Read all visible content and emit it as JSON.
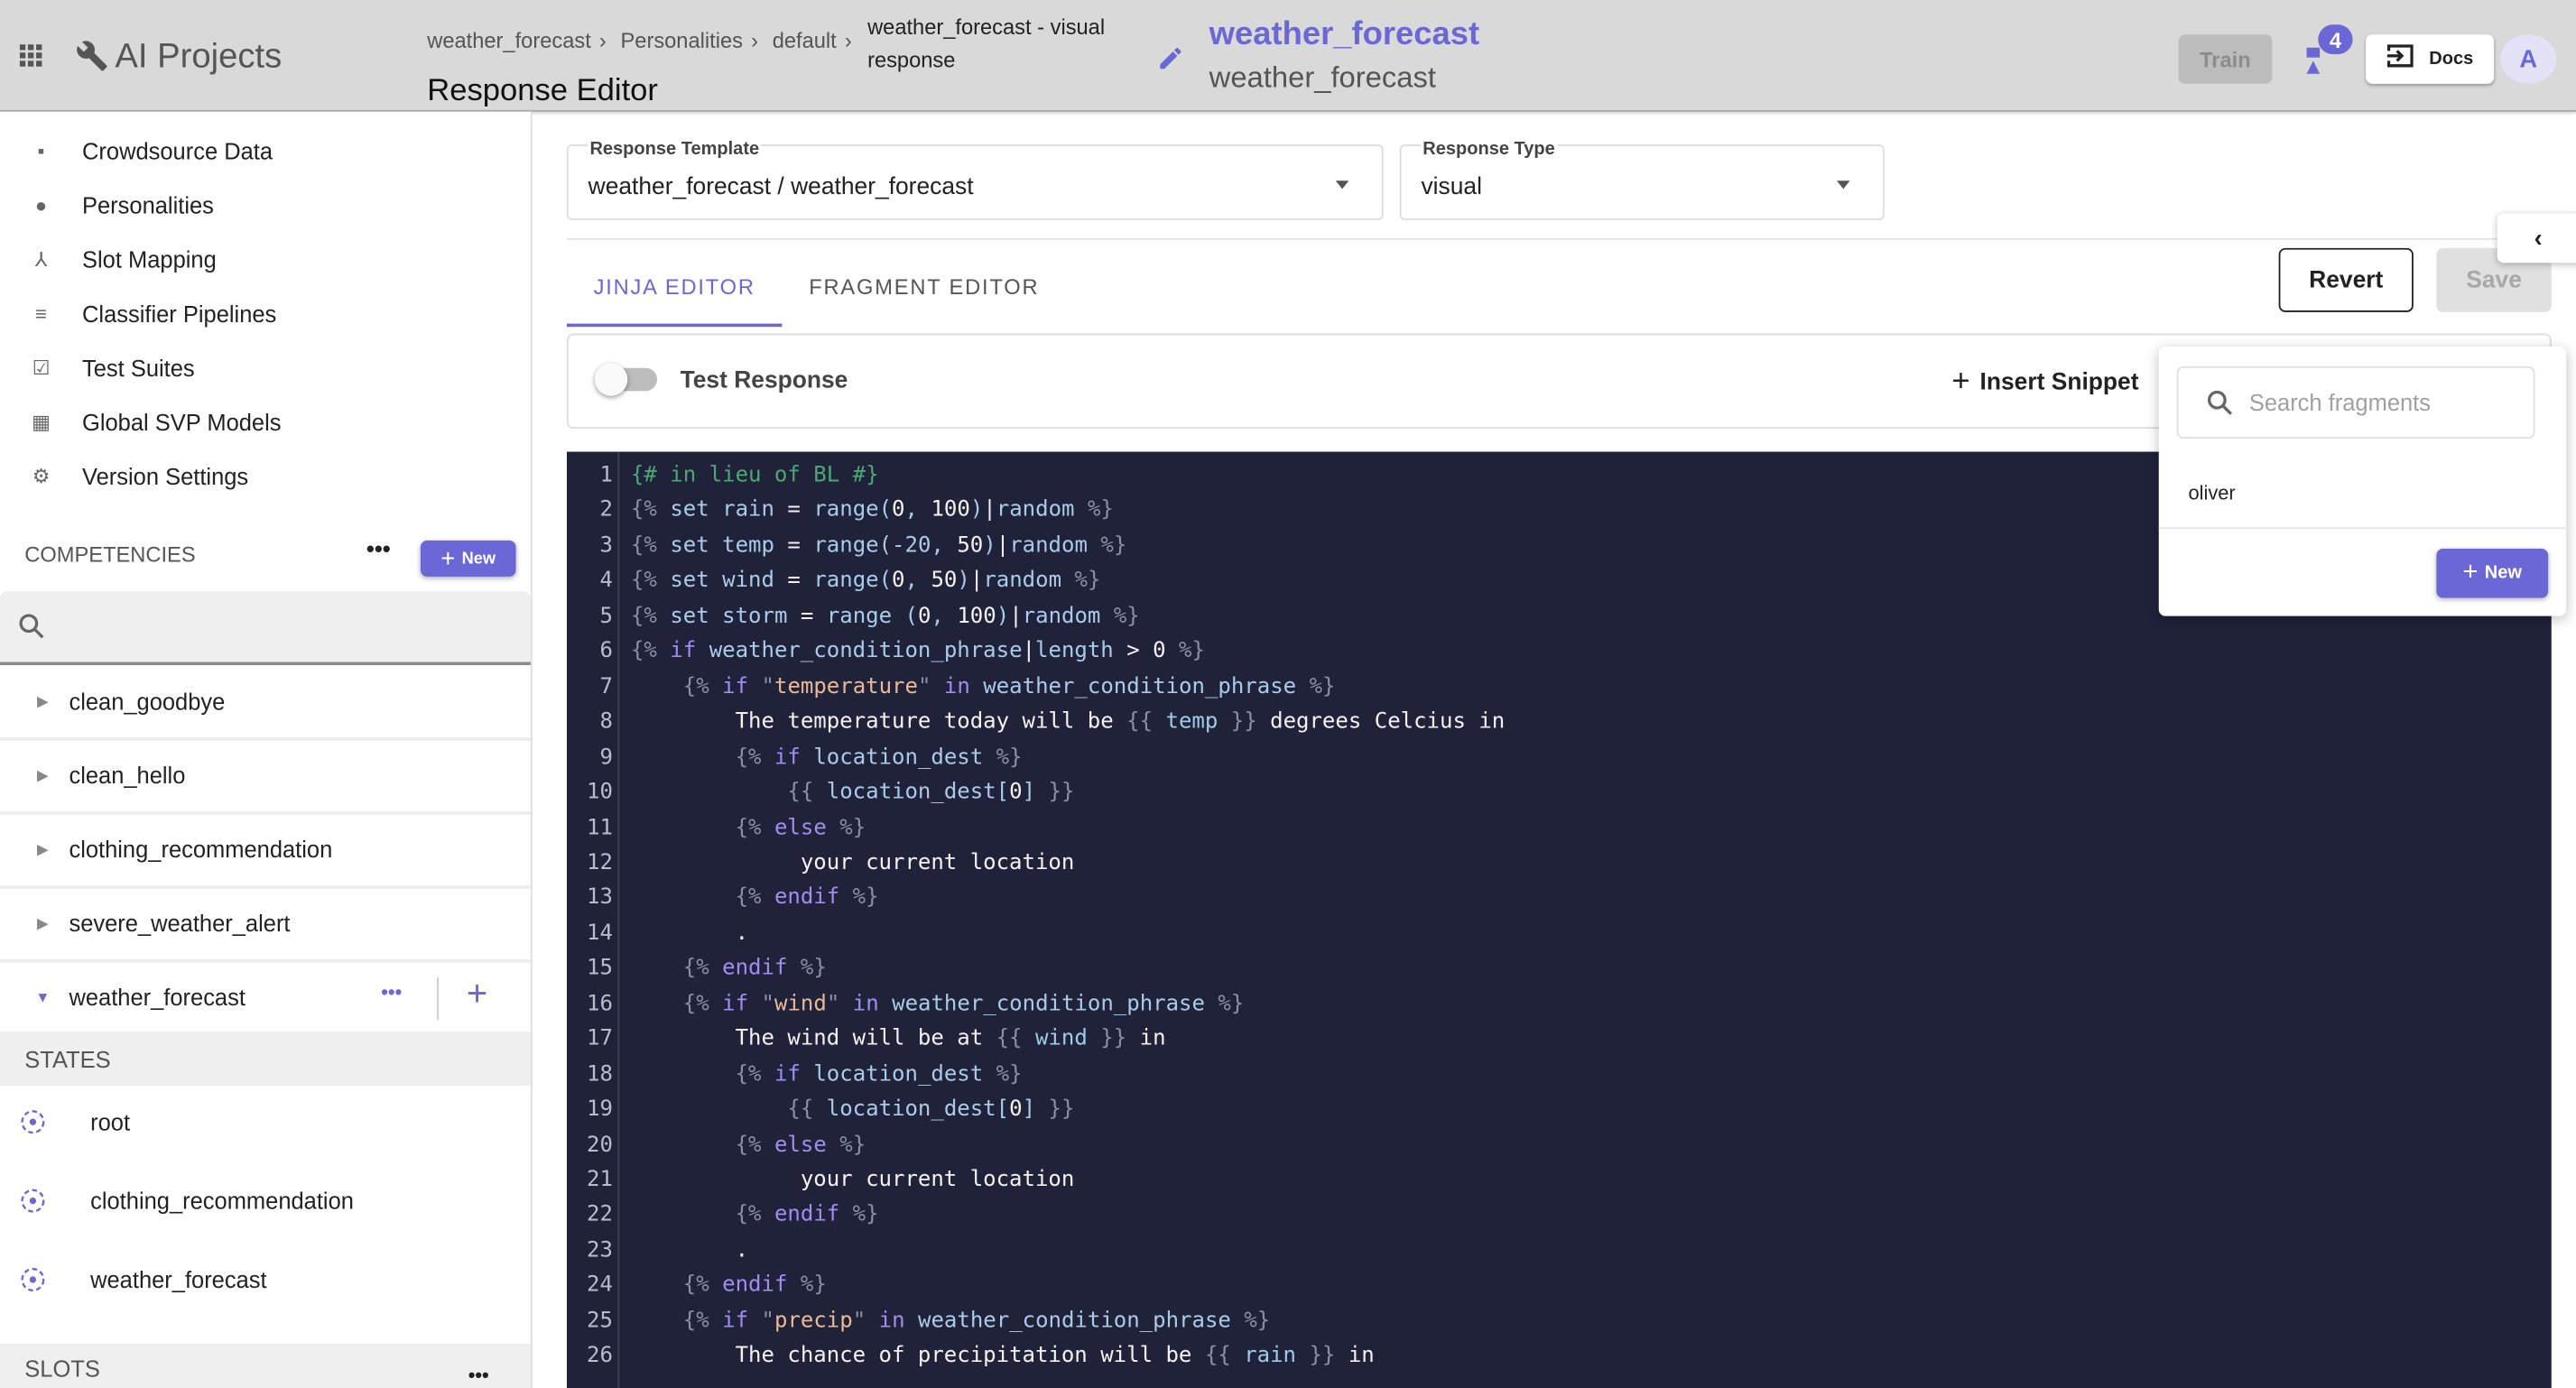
{
  "header": {
    "app_title": "AI Projects",
    "breadcrumbs": [
      "weather_forecast",
      "Personalities",
      "default"
    ],
    "breadcrumb_current": "weather_forecast - visual response",
    "page_title": "Response Editor",
    "competency_title": "weather_forecast",
    "competency_subtitle": "weather_forecast",
    "train_label": "Train",
    "notification_count": "4",
    "docs_label": "Docs",
    "avatar_initial": "A",
    "accent_color": "#6b67d6"
  },
  "sidebar": {
    "nav": [
      {
        "label": "Crowdsource Data",
        "icon": "chat-icon"
      },
      {
        "label": "Personalities",
        "icon": "person-icon"
      },
      {
        "label": "Slot Mapping",
        "icon": "hierarchy-icon"
      },
      {
        "label": "Classifier Pipelines",
        "icon": "lines-icon"
      },
      {
        "label": "Test Suites",
        "icon": "checkbox-icon"
      },
      {
        "label": "Global SVP Models",
        "icon": "grid-icon"
      },
      {
        "label": "Version Settings",
        "icon": "gear-icon"
      }
    ],
    "competencies_label": "COMPETENCIES",
    "new_label": "New",
    "competencies": [
      "clean_goodbye",
      "clean_hello",
      "clothing_recommendation",
      "severe_weather_alert",
      "weather_forecast"
    ],
    "states_label": "STATES",
    "states": [
      "root",
      "clothing_recommendation",
      "weather_forecast"
    ],
    "slots_label": "SLOTS"
  },
  "main": {
    "template_label": "Response Template",
    "template_value": "weather_forecast / weather_forecast",
    "type_label": "Response Type",
    "type_value": "visual",
    "tabs": [
      "JINJA EDITOR",
      "FRAGMENT EDITOR"
    ],
    "active_tab": 0,
    "revert_label": "Revert",
    "save_label": "Save",
    "test_response_label": "Test Response",
    "test_response_on": false,
    "insert_snippet_label": "Insert Snippet"
  },
  "fragments": {
    "search_placeholder": "Search fragments",
    "items": [
      "oliver"
    ],
    "new_label": "New"
  },
  "code_lines": [
    [
      [
        "c",
        "{# in lieu of BL #}"
      ]
    ],
    [
      [
        "d",
        "{% "
      ],
      [
        "s",
        "set rain "
      ],
      [
        "p",
        "= "
      ],
      [
        "s",
        "range("
      ],
      [
        "n",
        "0"
      ],
      [
        "s",
        ", "
      ],
      [
        "n",
        "100"
      ],
      [
        "s",
        ")"
      ],
      [
        "p",
        "|"
      ],
      [
        "s",
        "random "
      ],
      [
        "d",
        "%}"
      ]
    ],
    [
      [
        "d",
        "{% "
      ],
      [
        "s",
        "set temp "
      ],
      [
        "p",
        "= "
      ],
      [
        "s",
        "range(-20, "
      ],
      [
        "n",
        "50"
      ],
      [
        "s",
        ")"
      ],
      [
        "p",
        "|"
      ],
      [
        "s",
        "random "
      ],
      [
        "d",
        "%}"
      ]
    ],
    [
      [
        "d",
        "{% "
      ],
      [
        "s",
        "set wind "
      ],
      [
        "p",
        "= "
      ],
      [
        "s",
        "range("
      ],
      [
        "n",
        "0"
      ],
      [
        "s",
        ", "
      ],
      [
        "n",
        "50"
      ],
      [
        "s",
        ")"
      ],
      [
        "p",
        "|"
      ],
      [
        "s",
        "random "
      ],
      [
        "d",
        "%}"
      ]
    ],
    [
      [
        "d",
        "{% "
      ],
      [
        "s",
        "set storm "
      ],
      [
        "p",
        "= "
      ],
      [
        "s",
        "range ("
      ],
      [
        "n",
        "0"
      ],
      [
        "s",
        ", "
      ],
      [
        "n",
        "100"
      ],
      [
        "s",
        ")"
      ],
      [
        "p",
        "|"
      ],
      [
        "s",
        "random "
      ],
      [
        "d",
        "%}"
      ]
    ],
    [
      [
        "d",
        "{% "
      ],
      [
        "k",
        "if "
      ],
      [
        "s",
        "weather_condition_phrase"
      ],
      [
        "p",
        "|"
      ],
      [
        "s",
        "length "
      ],
      [
        "p",
        "> 0 "
      ],
      [
        "d",
        "%}"
      ]
    ],
    [
      [
        "p",
        "    "
      ],
      [
        "d",
        "{% "
      ],
      [
        "k",
        "if "
      ],
      [
        "d",
        "\""
      ],
      [
        "str",
        "temperature"
      ],
      [
        "d",
        "\" "
      ],
      [
        "k",
        "in "
      ],
      [
        "s",
        "weather_condition_phrase "
      ],
      [
        "d",
        "%}"
      ]
    ],
    [
      [
        "p",
        "        The temperature today will be "
      ],
      [
        "d",
        "{{ "
      ],
      [
        "v",
        "temp "
      ],
      [
        "d",
        "}} "
      ],
      [
        "p",
        "degrees Celcius in"
      ]
    ],
    [
      [
        "p",
        "        "
      ],
      [
        "d",
        "{% "
      ],
      [
        "k",
        "if "
      ],
      [
        "s",
        "location_dest "
      ],
      [
        "d",
        "%}"
      ]
    ],
    [
      [
        "p",
        "            "
      ],
      [
        "d",
        "{{ "
      ],
      [
        "s",
        "location_dest["
      ],
      [
        "n",
        "0"
      ],
      [
        "s",
        "] "
      ],
      [
        "d",
        "}}"
      ]
    ],
    [
      [
        "p",
        "        "
      ],
      [
        "d",
        "{% "
      ],
      [
        "k",
        "else "
      ],
      [
        "d",
        "%}"
      ]
    ],
    [
      [
        "p",
        "             your current location"
      ]
    ],
    [
      [
        "p",
        "        "
      ],
      [
        "d",
        "{% "
      ],
      [
        "k",
        "endif "
      ],
      [
        "d",
        "%}"
      ]
    ],
    [
      [
        "p",
        "        ."
      ]
    ],
    [
      [
        "p",
        "    "
      ],
      [
        "d",
        "{% "
      ],
      [
        "k",
        "endif "
      ],
      [
        "d",
        "%}"
      ]
    ],
    [
      [
        "p",
        "    "
      ],
      [
        "d",
        "{% "
      ],
      [
        "k",
        "if "
      ],
      [
        "d",
        "\""
      ],
      [
        "str",
        "wind"
      ],
      [
        "d",
        "\" "
      ],
      [
        "k",
        "in "
      ],
      [
        "s",
        "weather_condition_phrase "
      ],
      [
        "d",
        "%}"
      ]
    ],
    [
      [
        "p",
        "        The wind will be at "
      ],
      [
        "d",
        "{{ "
      ],
      [
        "v",
        "wind "
      ],
      [
        "d",
        "}} "
      ],
      [
        "p",
        "in"
      ]
    ],
    [
      [
        "p",
        "        "
      ],
      [
        "d",
        "{% "
      ],
      [
        "k",
        "if "
      ],
      [
        "s",
        "location_dest "
      ],
      [
        "d",
        "%}"
      ]
    ],
    [
      [
        "p",
        "            "
      ],
      [
        "d",
        "{{ "
      ],
      [
        "s",
        "location_dest["
      ],
      [
        "n",
        "0"
      ],
      [
        "s",
        "] "
      ],
      [
        "d",
        "}}"
      ]
    ],
    [
      [
        "p",
        "        "
      ],
      [
        "d",
        "{% "
      ],
      [
        "k",
        "else "
      ],
      [
        "d",
        "%}"
      ]
    ],
    [
      [
        "p",
        "             your current location"
      ]
    ],
    [
      [
        "p",
        "        "
      ],
      [
        "d",
        "{% "
      ],
      [
        "k",
        "endif "
      ],
      [
        "d",
        "%}"
      ]
    ],
    [
      [
        "p",
        "        ."
      ]
    ],
    [
      [
        "p",
        "    "
      ],
      [
        "d",
        "{% "
      ],
      [
        "k",
        "endif "
      ],
      [
        "d",
        "%}"
      ]
    ],
    [
      [
        "p",
        "    "
      ],
      [
        "d",
        "{% "
      ],
      [
        "k",
        "if "
      ],
      [
        "d",
        "\""
      ],
      [
        "str",
        "precip"
      ],
      [
        "d",
        "\" "
      ],
      [
        "k",
        "in "
      ],
      [
        "s",
        "weather_condition_phrase "
      ],
      [
        "d",
        "%}"
      ]
    ],
    [
      [
        "p",
        "        The chance of precipitation will be "
      ],
      [
        "d",
        "{{ "
      ],
      [
        "v",
        "rain "
      ],
      [
        "d",
        "}} "
      ],
      [
        "p",
        "in"
      ]
    ]
  ]
}
